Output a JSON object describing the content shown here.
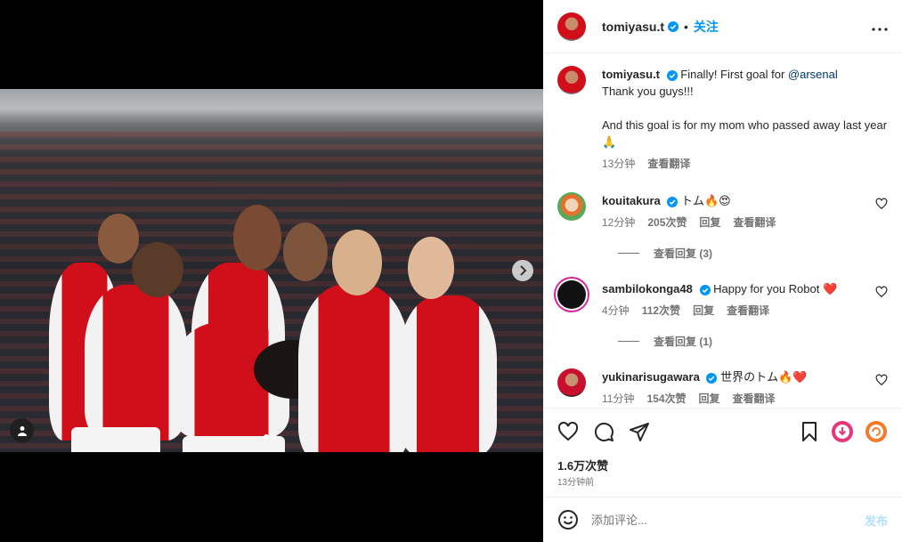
{
  "header": {
    "username": "tomiyasu.t",
    "separator": "•",
    "follow_label": "关注",
    "more_label": "•••"
  },
  "caption": {
    "username": "tomiyasu.t",
    "text": "Finally! First goal for ",
    "mention": "@arsenal",
    "text2": "Thank you guys!!!\n\nAnd this goal is for my mom who passed away last year 🙏",
    "time": "13分钟",
    "translate": "查看翻译"
  },
  "comments": [
    {
      "username": "kouitakura",
      "text": "トム🔥😍",
      "time": "12分钟",
      "likes": "205次赞",
      "reply": "回复",
      "translate": "查看翻译",
      "view_replies": "查看回复 (3)"
    },
    {
      "username": "sambilokonga48",
      "text": "Happy for you Robot ❤️",
      "time": "4分钟",
      "likes": "112次赞",
      "reply": "回复",
      "translate": "查看翻译",
      "view_replies": "查看回复 (1)"
    },
    {
      "username": "yukinarisugawara",
      "text": "世界のトム🔥❤️",
      "time": "11分钟",
      "likes": "154次赞",
      "reply": "回复",
      "translate": "查看翻译"
    }
  ],
  "likes_count": "1.6万次赞",
  "post_time": "13分钟前",
  "add_comment": {
    "placeholder": "添加评论...",
    "post_label": "发布"
  },
  "colors": {
    "accent": "#0095f6",
    "post_disabled": "#b2dffc",
    "text": "#262626",
    "secondary": "#737373"
  },
  "icons": [
    "verified-badge-icon",
    "more-icon",
    "heart-icon",
    "comment-icon",
    "share-icon",
    "bookmark-icon",
    "chevron-right-icon",
    "user-tag-icon",
    "emoji-icon"
  ]
}
